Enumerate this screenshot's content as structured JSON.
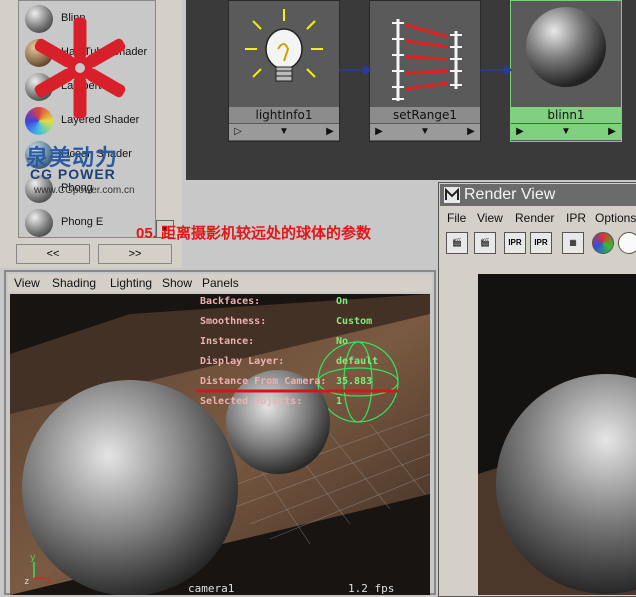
{
  "material_list": {
    "items": [
      {
        "label": "Blinn",
        "color": "#8a8a8a"
      },
      {
        "label": "Hair Tube Shader",
        "color": "#8a6a4a"
      },
      {
        "label": "Lambert",
        "color": "#8a8a8a"
      },
      {
        "label": "Layered Shader",
        "color": "#5060c0"
      },
      {
        "label": "Ocean Shader",
        "color": "#5b7fa0"
      },
      {
        "label": "Phong",
        "color": "#8a8a8a"
      },
      {
        "label": "Phong E",
        "color": "#8a8a8a"
      }
    ],
    "nav_prev": "<<",
    "nav_next": ">>"
  },
  "logo": {
    "cn": "泉美动力",
    "en": "CG POWER",
    "url": "www.CGpower.com.cn"
  },
  "graph": {
    "nodes": [
      {
        "name": "lightInfo1"
      },
      {
        "name": "setRange1"
      },
      {
        "name": "blinn1"
      }
    ]
  },
  "caption": "05. 距离摄影机较远处的球体的参数",
  "viewport": {
    "menu": [
      "View",
      "Shading",
      "Lighting",
      "Show",
      "Panels"
    ],
    "hud": [
      {
        "label": "Backfaces:",
        "value": "On"
      },
      {
        "label": "Smoothness:",
        "value": "Custom"
      },
      {
        "label": "Instance:",
        "value": "No"
      },
      {
        "label": "Display Layer:",
        "value": "default"
      },
      {
        "label": "Distance From Camera:",
        "value": "35.883"
      },
      {
        "label": "Selected Objects:",
        "value": "1"
      }
    ],
    "camera": "camera1",
    "fps": "1.2 fps"
  },
  "render_view": {
    "title": "Render View",
    "menu": [
      "File",
      "View",
      "Render",
      "IPR",
      "Options"
    ],
    "tools": [
      "render-icon",
      "redo-render-icon",
      "ipr-icon",
      "ipr-refresh-icon",
      "snapshot-icon",
      "color-channel-icon",
      "alpha-icon"
    ]
  }
}
